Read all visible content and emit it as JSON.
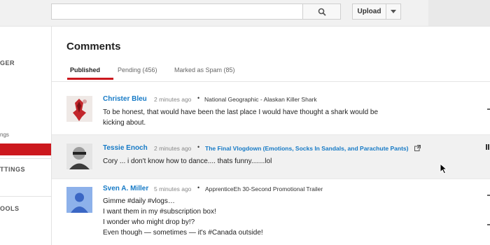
{
  "header": {
    "search": {
      "value": "",
      "placeholder": ""
    },
    "search_icon": "search-icon",
    "upload_label": "Upload",
    "upload_menu_icon": "chevron-down-icon"
  },
  "sidebar": {
    "items": [
      {
        "label": "GER"
      },
      {
        "label": "ngs"
      },
      {
        "label": "TTINGS"
      },
      {
        "label": "OOLS"
      }
    ],
    "accent": "#cc181e"
  },
  "main": {
    "title": "Comments",
    "tabs": [
      {
        "label": "Published",
        "active": true
      },
      {
        "label": "Pending (456)",
        "active": false
      },
      {
        "label": "Marked as Spam (85)",
        "active": false
      }
    ],
    "comments": [
      {
        "author": "Christer Bleu",
        "time": "2 minutes ago",
        "video": "National Geographic - Alaskan Killer Shark",
        "video_is_link": false,
        "lines": [
          "To be honest, that would have been the last place I would have thought a shark would be",
          "kicking about."
        ]
      },
      {
        "author": "Tessie Enoch",
        "time": "2 minutes ago",
        "video": "The Final Vlogdown (Emotions, Socks In Sandals, and Parachute Pants)",
        "video_is_link": true,
        "external_icon": "external-link-icon",
        "lines": [
          "Cory ... i don't know how to dance.... thats funny.......lol"
        ]
      },
      {
        "author": "Sven A. Miller",
        "time": "5 minutes ago",
        "video": "ApprenticeEh 30-Second Promotional Trailer",
        "video_is_link": false,
        "lines": [
          "Gimme #daily #vlogs…",
          "I want them in my #subscription box!",
          "I wonder who might drop by!?",
          "Even though — sometimes — it's #Canada outside!"
        ]
      }
    ]
  },
  "colors": {
    "link": "#167ac6",
    "accent": "#cc181e",
    "hover_row": "#f1f1f1"
  }
}
